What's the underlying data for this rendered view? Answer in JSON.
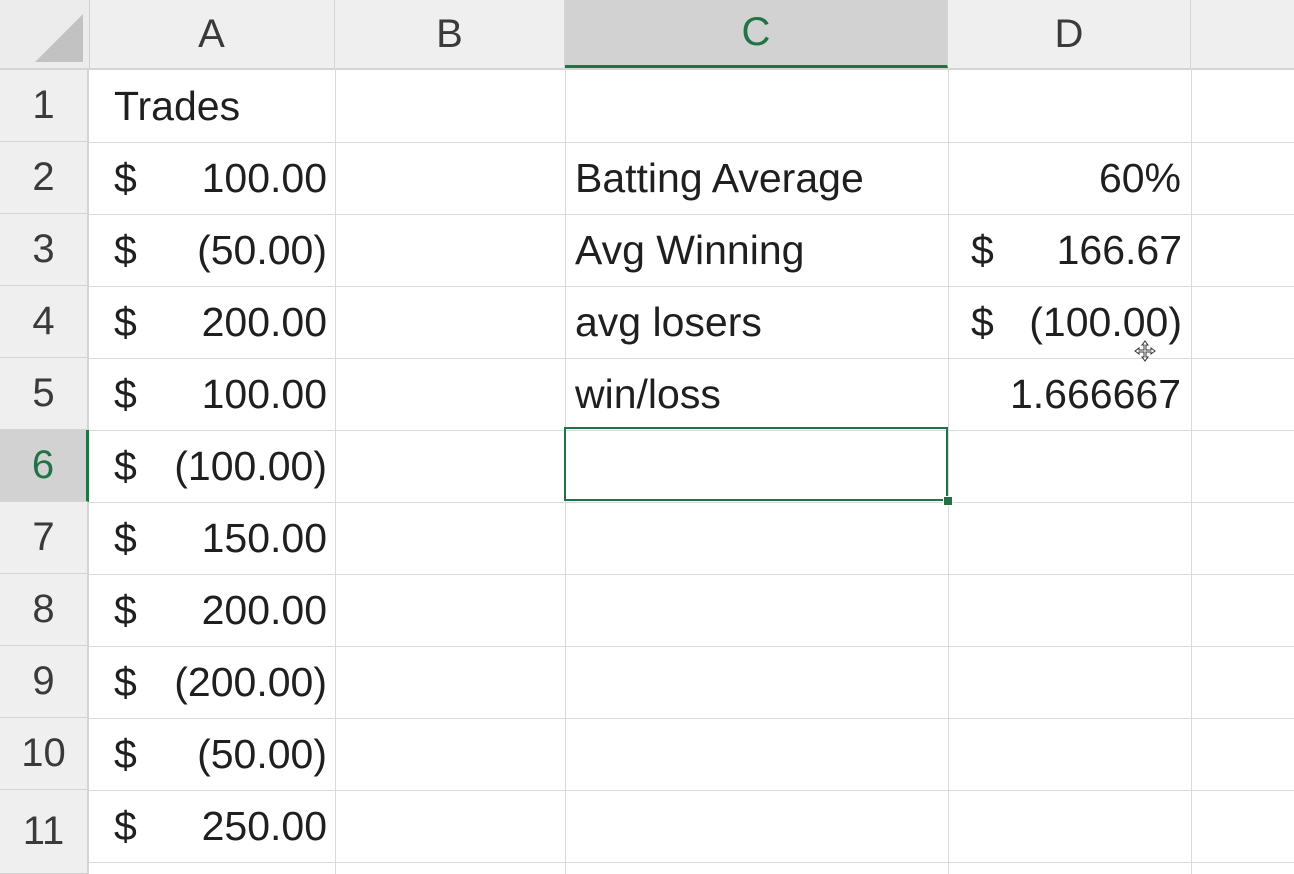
{
  "columns": [
    "A",
    "B",
    "C",
    "D"
  ],
  "rows": [
    "1",
    "2",
    "3",
    "4",
    "5",
    "6",
    "7",
    "8",
    "9",
    "10",
    "11"
  ],
  "selected_cell": "C6",
  "accent_color": "#217346",
  "column_a": {
    "header": "Trades",
    "trades": [
      {
        "symbol": "$",
        "value": "100.00 "
      },
      {
        "symbol": "$",
        "value": "(50.00)"
      },
      {
        "symbol": "$",
        "value": "200.00 "
      },
      {
        "symbol": "$",
        "value": "100.00 "
      },
      {
        "symbol": "$",
        "value": "(100.00)"
      },
      {
        "symbol": "$",
        "value": "150.00 "
      },
      {
        "symbol": "$",
        "value": "200.00 "
      },
      {
        "symbol": "$",
        "value": "(200.00)"
      },
      {
        "symbol": "$",
        "value": "(50.00)"
      },
      {
        "symbol": "$",
        "value": "250.00 "
      }
    ]
  },
  "stats": {
    "batting_average": {
      "label": "Batting Average",
      "value": "60%"
    },
    "avg_winning": {
      "label": "Avg Winning",
      "symbol": "$",
      "value": "166.67 "
    },
    "avg_losers": {
      "label": "avg losers",
      "symbol": "$",
      "value": "(100.00)"
    },
    "win_loss": {
      "label": "win/loss",
      "value": "1.666667"
    }
  },
  "icons": {
    "cursor": "move-cursor-icon",
    "corner": "select-all-icon"
  }
}
